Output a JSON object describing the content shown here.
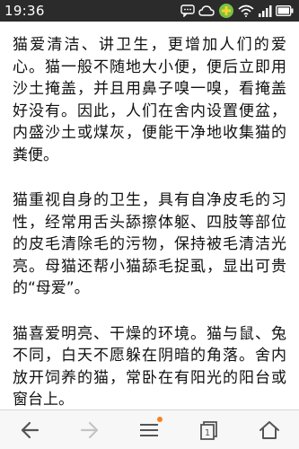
{
  "status_bar": {
    "time": "19:36",
    "icons": [
      "message-icon",
      "cloud-icon",
      "app-plus-icon",
      "wifi-icon",
      "signal-icon",
      "battery-icon"
    ],
    "battery_percent": "",
    "accent_color": "#7bc043"
  },
  "article": {
    "paragraphs": [
      "猫爱清洁、讲卫生，更增加人们的爱心。猫一般不随地大小便，便后立即用沙土掩盖，并且用鼻子嗅一嗅，看掩盖好没有。因此，人们在舍内设置便盆，内盛沙土或煤灰，便能干净地收集猫的粪便。",
      "猫重视自身的卫生，具有自净皮毛的习性，经常用舌头舔擦体躯、四肢等部位的皮毛清除毛的污物，保持被毛清洁光亮。母猫还帮小猫舔毛捉虱，显出可贵的“母爱”。",
      "猫喜爱明亮、干燥的环境。猫与鼠、兔不同，白天不愿躲在阴暗的角落。舍内放开饲养的猫，常卧在有阳光的阳台或窗台上。"
    ]
  },
  "nav_bar": {
    "buttons": [
      "back-arrow-icon",
      "forward-arrow-icon",
      "menu-icon",
      "tabs-icon",
      "home-icon"
    ],
    "tab_count": "1",
    "notification_dot_color": "#f5821f"
  }
}
